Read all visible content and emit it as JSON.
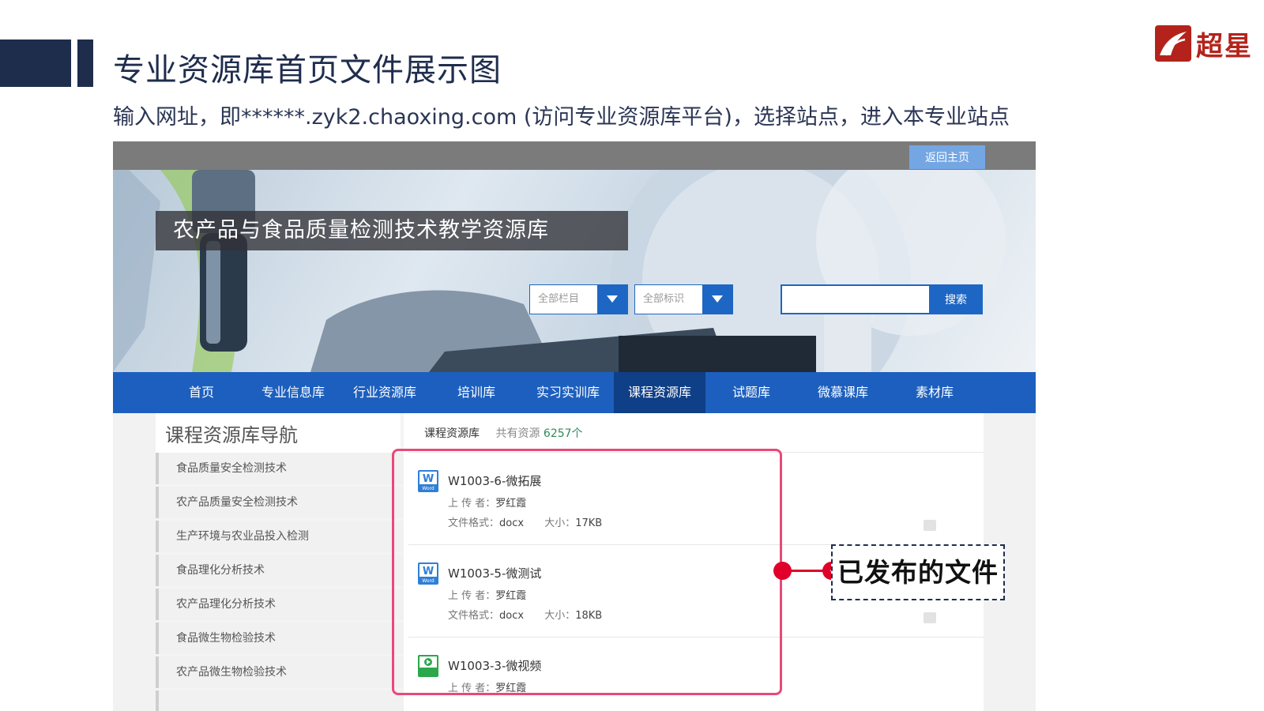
{
  "slide": {
    "title": "专业资源库首页文件展示图",
    "subtitle": "输入网址，即******.zyk2.chaoxing.com (访问专业资源库平台)，选择站点，进入本专业站点",
    "brand_text": "超星"
  },
  "site": {
    "home_button": "返回主页",
    "title": "农产品与食品质量检测技术教学资源库",
    "select_category": "全部栏目",
    "select_tag": "全部标识",
    "search_value": "",
    "search_button": "搜索",
    "nav": [
      "首页",
      "专业信息库",
      "行业资源库",
      "培训库",
      "实习实训库",
      "课程资源库",
      "试题库",
      "微慕课库",
      "素材库"
    ],
    "nav_active": "课程资源库"
  },
  "sidebar": {
    "title": "课程资源库导航",
    "items": [
      "食品质量安全检测技术",
      "农产品质量安全检测技术",
      "生产环境与农业品投入检测",
      "食品理化分析技术",
      "农产品理化分析技术",
      "食品微生物检验技术",
      "农产品微生物检验技术"
    ]
  },
  "main": {
    "breadcrumb": "课程资源库",
    "total_label": "共有资源",
    "total_count": "6257个",
    "files": [
      {
        "name": "W1003-6-微拓展",
        "uploader_label": "上 传 者：",
        "uploader": "罗红霞",
        "format_label": "文件格式：",
        "format": "docx",
        "size_label": "大小：",
        "size": "17KB",
        "icon": "word-file-icon"
      },
      {
        "name": "W1003-5-微测试",
        "uploader_label": "上 传 者：",
        "uploader": "罗红霞",
        "format_label": "文件格式：",
        "format": "docx",
        "size_label": "大小：",
        "size": "18KB",
        "icon": "word-file-icon"
      },
      {
        "name": "W1003-3-微视频",
        "uploader_label": "上 传 者：",
        "uploader": "罗红霞",
        "format_label": "",
        "format": "",
        "size_label": "",
        "size": "",
        "icon": "video-file-icon"
      }
    ]
  },
  "annotation": {
    "callout": "已发布的文件",
    "highlight_color": "#e8497a",
    "connector_color": "#e0002a"
  },
  "colors": {
    "nav_blue": "#1d5fbe",
    "nav_active": "#0f3f86",
    "title_dark": "#1f2d4d",
    "brand_red": "#b3231b"
  }
}
